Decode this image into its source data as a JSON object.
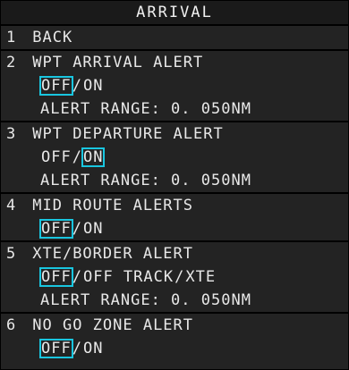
{
  "title": "ARRIVAL",
  "colors": {
    "background": "#232323",
    "text": "#e8e8e8",
    "selection_box": "#19c6e0"
  },
  "items": [
    {
      "number": "1",
      "label": "BACK"
    },
    {
      "number": "2",
      "label": "WPT ARRIVAL ALERT",
      "options": [
        "OFF",
        "ON"
      ],
      "selected": "OFF",
      "range": "ALERT  RANGE: 0. 050NM"
    },
    {
      "number": "3",
      "label": "WPT DEPARTURE ALERT",
      "options": [
        "OFF",
        "ON"
      ],
      "selected": "ON",
      "range": "ALERT  RANGE: 0. 050NM"
    },
    {
      "number": "4",
      "label": "MID ROUTE ALERTS",
      "options": [
        "OFF",
        "ON"
      ],
      "selected": "OFF"
    },
    {
      "number": "5",
      "label": "XTE/BORDER ALERT",
      "options": [
        "OFF",
        "OFF TRACK",
        "XTE"
      ],
      "selected": "OFF",
      "range": "ALERT  RANGE: 0. 050NM"
    },
    {
      "number": "6",
      "label": "NO GO ZONE ALERT",
      "options": [
        "OFF",
        "ON"
      ],
      "selected": "OFF"
    }
  ],
  "separator": "/"
}
